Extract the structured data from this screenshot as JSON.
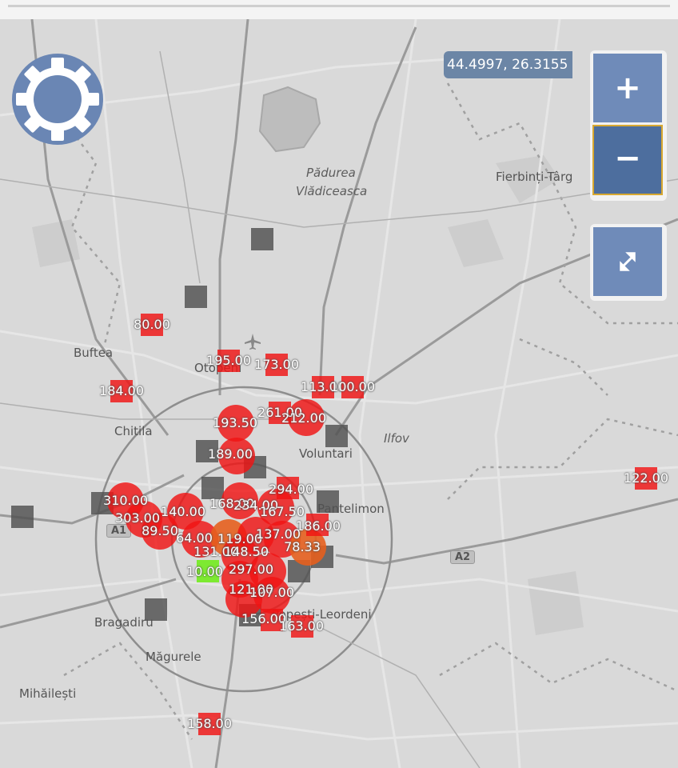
{
  "map": {
    "coordinates": "44.4997, 26.3155",
    "zoom_in_label": "+",
    "zoom_out_label": "−",
    "icons": [
      "settings-gear-icon",
      "expand-arrows-icon",
      "airport-icon"
    ],
    "colors": {
      "high": "#f01414",
      "medium": "#e65f1e",
      "low": "#78eb28",
      "nodata": "#505050",
      "control": "#6f8bb9"
    }
  },
  "places": {
    "padurea": "Pădurea",
    "vladiceasca": "Vlădiceasca",
    "fierbinti": "Fierbinți-Târg",
    "buftea": "Buftea",
    "chitila": "Chitila",
    "voluntari": "Voluntari",
    "ilfov": "Ilfov",
    "pantelimon": "Pantelimon",
    "bragadiru": "Bragadiru",
    "magurele": "Măgurele",
    "mihailesti": "Mihăilești",
    "otopeni": "Otopeni",
    "popesti_leordeni": "Popești-Leordeni",
    "a2": "A2",
    "a1": "A1"
  },
  "stations": {
    "s80": "80.00",
    "s195": "195.00",
    "s173": "173.00",
    "s184": "184.00",
    "s113": "113.00",
    "s100": "100.00",
    "s261": "261.00",
    "s193": "193.50",
    "s212": "212.00",
    "s189": "189.00",
    "s294": "294.00",
    "s122": "122.00",
    "s310": "310.00",
    "s303": "303.00",
    "s140": "140.00",
    "s89": "89.50",
    "s168": "168.00",
    "s234": "234.00",
    "s167": "167.50",
    "s186": "186.00",
    "s64": "64.00",
    "s119": "119.00",
    "s137": "137.00",
    "s78": "78.33",
    "s131": "131.00",
    "s148": "148.50",
    "s10": "10.00",
    "s297": "297.00",
    "s121": "121.00",
    "s107": "107.00",
    "s156": "156.00",
    "s163": "163.00",
    "s158": "158.00"
  }
}
